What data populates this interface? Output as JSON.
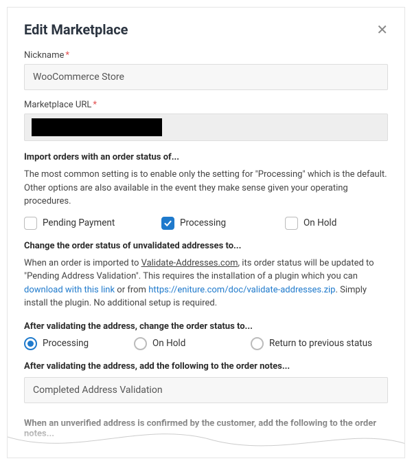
{
  "modal": {
    "title": "Edit Marketplace"
  },
  "nickname": {
    "label": "Nickname",
    "value": "WooCommerce Store"
  },
  "url": {
    "label": "Marketplace URL"
  },
  "import_status": {
    "heading": "Import orders with an order status of...",
    "desc": "The most common setting is to enable only the setting for \"Processing\" which is the default. Other options are also available in the event they make sense given your operating procedures.",
    "options": {
      "pending": "Pending Payment",
      "processing": "Processing",
      "onhold": "On Hold"
    }
  },
  "unvalidated": {
    "heading": "Change the order status of unvalidated addresses to...",
    "pre": "When an order is imported to ",
    "site": "Validate-Addresses.com",
    "mid1": ", its order status will be updated to \"Pending Address Validation\". This requires the installation of a plugin which you can ",
    "link1": "download with this link",
    "mid2": " or from ",
    "link2": "https://eniture.com/doc/validate-addresses.zip",
    "post": ". Simply install the plugin. No additional setup is required."
  },
  "after_validate": {
    "heading": "After validating the address, change the order status to...",
    "options": {
      "processing": "Processing",
      "onhold": "On Hold",
      "return": "Return to previous status"
    }
  },
  "order_notes": {
    "heading": "After validating the address, add the following to the order notes...",
    "value": "Completed Address Validation"
  },
  "unverified": {
    "heading": "When an unverified address is confirmed by the customer, add the following to the order notes..."
  }
}
